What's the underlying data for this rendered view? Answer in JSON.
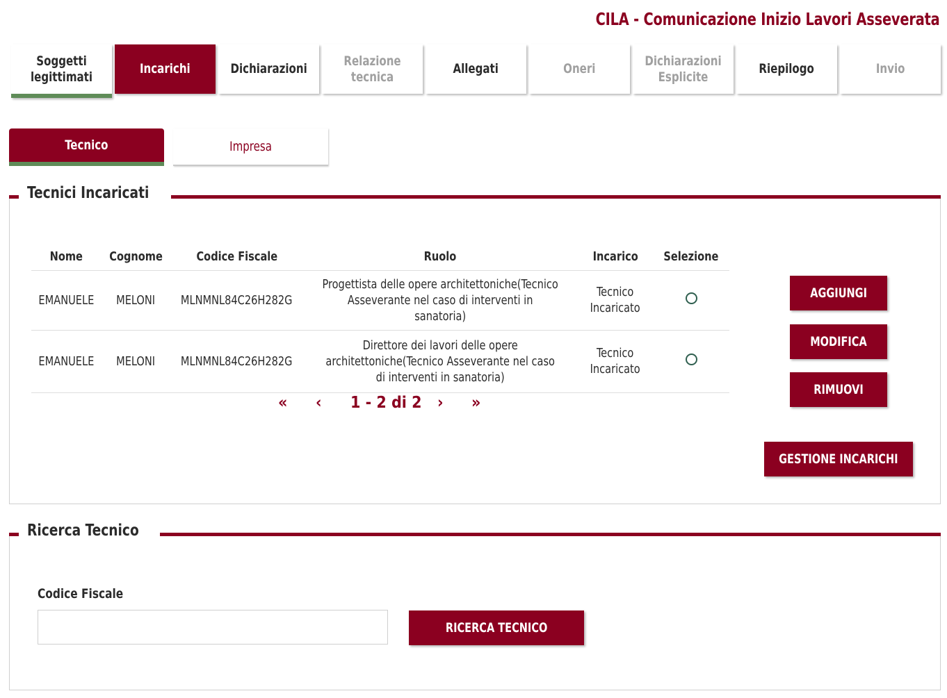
{
  "header": {
    "title": "CILA - Comunicazione Inizio Lavori Asseverata"
  },
  "steps": [
    {
      "label": "Soggetti legittimati",
      "state": "done"
    },
    {
      "label": "Incarichi",
      "state": "active"
    },
    {
      "label": "Dichiarazioni",
      "state": "enabled"
    },
    {
      "label": "Relazione tecnica",
      "state": "disabled"
    },
    {
      "label": "Allegati",
      "state": "enabled"
    },
    {
      "label": "Oneri",
      "state": "disabled"
    },
    {
      "label": "Dichiarazioni Esplicite",
      "state": "disabled"
    },
    {
      "label": "Riepilogo",
      "state": "enabled"
    },
    {
      "label": "Invio",
      "state": "disabled"
    }
  ],
  "subtabs": [
    {
      "label": "Tecnico",
      "active": true
    },
    {
      "label": "Impresa",
      "active": false
    }
  ],
  "incaricati": {
    "title": "Tecnici Incaricati",
    "columns": [
      "Nome",
      "Cognome",
      "Codice Fiscale",
      "Ruolo",
      "Incarico",
      "Selezione"
    ],
    "rows": [
      {
        "nome": "EMANUELE",
        "cognome": "MELONI",
        "cf": "MLNMNL84C26H282G",
        "ruolo": "Progettista delle opere architettoniche(Tecnico Asseverante nel caso di interventi in sanatoria)",
        "incarico": "Tecnico Incaricato",
        "selected": false
      },
      {
        "nome": "EMANUELE",
        "cognome": "MELONI",
        "cf": "MLNMNL84C26H282G",
        "ruolo": "Direttore dei lavori delle opere architettoniche(Tecnico Asseverante nel caso di interventi in sanatoria)",
        "incarico": "Tecnico Incaricato",
        "selected": false
      }
    ],
    "pager": {
      "first": "«",
      "prev": "‹",
      "info": "1 - 2 di 2",
      "next": "›",
      "last": "»"
    },
    "buttons": {
      "add": "AGGIUNGI",
      "edit": "MODIFICA",
      "remove": "RIMUOVI",
      "manage": "GESTIONE INCARICHI"
    }
  },
  "ricerca": {
    "title": "Ricerca Tecnico",
    "field_label": "Codice Fiscale",
    "field_value": "",
    "button": "RICERCA TECNICO"
  },
  "colors": {
    "accent": "#8b0020",
    "done": "#5f8c58"
  }
}
